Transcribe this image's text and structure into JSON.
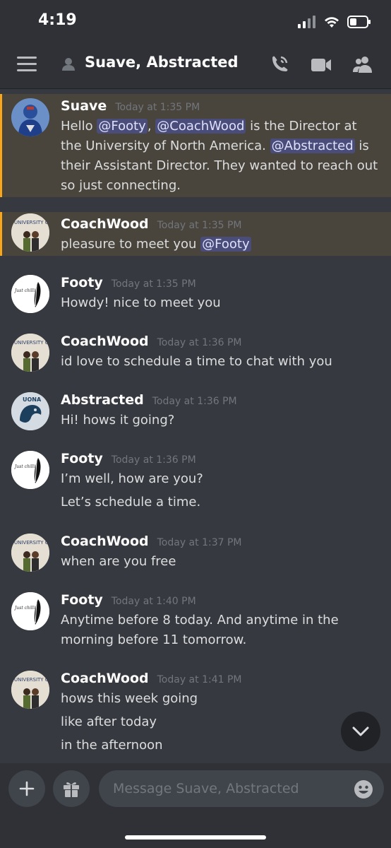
{
  "status_bar": {
    "time": "4:19"
  },
  "header": {
    "title": "Suave, Abstracted",
    "icons": [
      "menu-icon",
      "user-icon",
      "call-icon",
      "video-icon",
      "members-icon"
    ]
  },
  "messages": [
    {
      "author": "Suave",
      "time": "Today at 1:35 PM",
      "avatar": "captain-avatar",
      "lines": [
        "Hello @Footy, @CoachWood is the Director at the University of North America. @Abstracted is their Assistant Director. They wanted to reach out so just connecting."
      ],
      "parts": {
        "t1": "Hello ",
        "m1": "@Footy",
        "t2": ", ",
        "m2": "@CoachWood",
        "t3": " is the Director at the University of North America. ",
        "m3": "@Abstracted",
        "t4": " is their Assistant Director. They wanted to reach out so just connecting."
      }
    },
    {
      "author": "CoachWood",
      "time": "Today at 1:35 PM",
      "avatar": "university-avatar",
      "parts": {
        "t1": "pleasure to meet you ",
        "m1": "@Footy"
      }
    },
    {
      "author": "Footy",
      "time": "Today at 1:35 PM",
      "avatar": "feather-avatar",
      "lines": [
        "Howdy! nice to meet you"
      ]
    },
    {
      "author": "CoachWood",
      "time": "Today at 1:36 PM",
      "avatar": "university-avatar",
      "lines": [
        "id love to schedule a time to chat with you"
      ]
    },
    {
      "author": "Abstracted",
      "time": "Today at 1:36 PM",
      "avatar": "uona-avatar",
      "lines": [
        "Hi! hows it going?"
      ]
    },
    {
      "author": "Footy",
      "time": "Today at 1:36 PM",
      "avatar": "feather-avatar",
      "lines": [
        "I’m well, how are you?",
        "Let’s schedule a time."
      ]
    },
    {
      "author": "CoachWood",
      "time": "Today at 1:37 PM",
      "avatar": "university-avatar",
      "lines": [
        "when are you free"
      ]
    },
    {
      "author": "Footy",
      "time": "Today at 1:40 PM",
      "avatar": "feather-avatar",
      "lines": [
        "Anytime before 8 today. And anytime in the morning before 11 tomorrow."
      ]
    },
    {
      "author": "CoachWood",
      "time": "Today at 1:41 PM",
      "avatar": "university-avatar",
      "lines": [
        "hows this week going",
        "like after today",
        "in the afternoon"
      ]
    }
  ],
  "avatar_text": {
    "university": "UNIVERSITY OF NORTH AMERICA",
    "footy": "Just chillin'",
    "uona": "UONA"
  },
  "composer": {
    "placeholder": "Message Suave, Abstracted"
  },
  "colors": {
    "background": "#36393f",
    "header": "#2f3136",
    "mention_highlight": "#49443c",
    "mention_bar": "#faa61a",
    "mention_pill": "#4a4d7a"
  }
}
